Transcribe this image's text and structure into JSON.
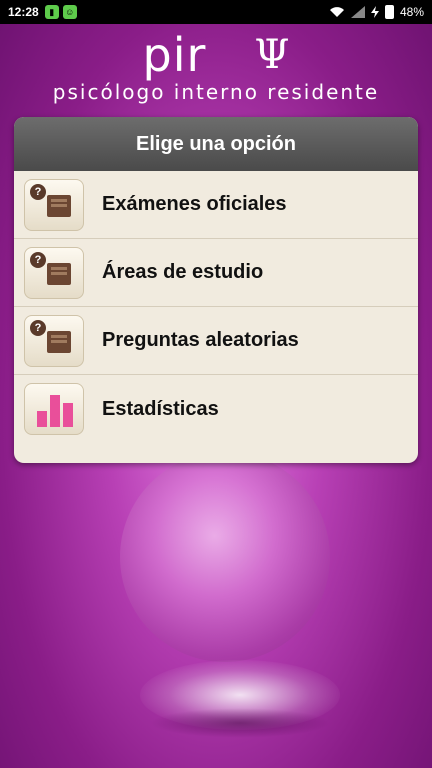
{
  "status_bar": {
    "time": "12:28",
    "battery": "48%",
    "icons": [
      "sim-icon",
      "android-icon",
      "wifi-icon",
      "signal-icon",
      "charging-icon",
      "battery-icon"
    ]
  },
  "header": {
    "logo_text": "pir",
    "psi_symbol": "Ψ",
    "subtitle": "psicólogo interno residente"
  },
  "menu": {
    "title": "Elige una opción",
    "items": [
      {
        "label": "Exámenes oficiales",
        "icon": "book-question-icon"
      },
      {
        "label": "Áreas de estudio",
        "icon": "book-question-icon"
      },
      {
        "label": "Preguntas aleatorias",
        "icon": "book-question-icon"
      },
      {
        "label": "Estadísticas",
        "icon": "bar-chart-icon"
      }
    ]
  },
  "colors": {
    "background": "#b840b5",
    "panel": "#f1ebdf",
    "header_bar": "#5a5a5a",
    "book": "#6b4632",
    "bars": "#e94f9a"
  }
}
